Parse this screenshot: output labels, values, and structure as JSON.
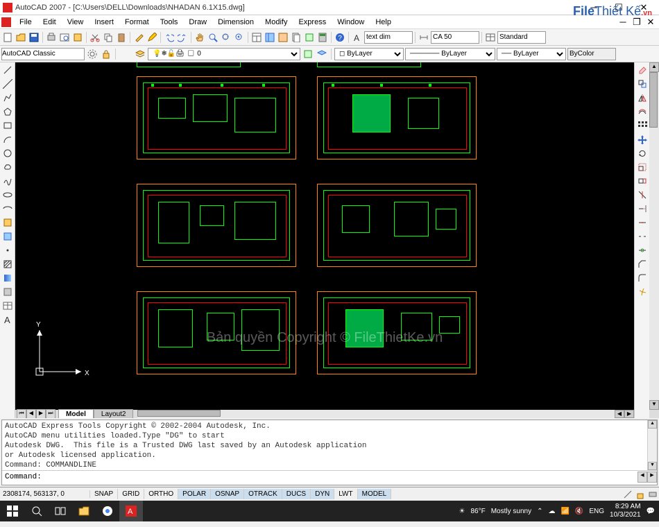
{
  "window": {
    "title": "AutoCAD 2007 - [C:\\Users\\DELL\\Downloads\\NHADAN 6.1X15.dwg]"
  },
  "menu": {
    "items": [
      "File",
      "Edit",
      "View",
      "Insert",
      "Format",
      "Tools",
      "Draw",
      "Dimension",
      "Modify",
      "Express",
      "Window",
      "Help"
    ]
  },
  "toolbars": {
    "textstyle": "text dim",
    "dimstyle": "CA 50",
    "tablestyle": "Standard",
    "workspace": "AutoCAD Classic",
    "layer": "0",
    "layerprop1": "ByLayer",
    "layerprop2": "ByLayer",
    "layerprop3": "ByLayer",
    "plotstyle": "ByColor"
  },
  "tabs": {
    "model": "Model",
    "layout": "Layout2"
  },
  "command": {
    "history": "AutoCAD Express Tools Copyright © 2002-2004 Autodesk, Inc.\nAutoCAD menu utilities loaded.Type \"DG\" to start\nAutodesk DWG.  This file is a Trusted DWG last saved by an Autodesk application\nor Autodesk licensed application.\nCommand: COMMANDLINE",
    "prompt": "Command:"
  },
  "status": {
    "coords": "2308174, 563137, 0",
    "buttons": [
      "SNAP",
      "GRID",
      "ORTHO",
      "POLAR",
      "OSNAP",
      "OTRACK",
      "DUCS",
      "DYN",
      "LWT",
      "MODEL"
    ]
  },
  "taskbar": {
    "weather_temp": "86°F",
    "weather_cond": "Mostly sunny",
    "lang": "ENG",
    "time": "8:29 AM",
    "date": "10/3/2021"
  },
  "watermark": {
    "brand1": "File",
    "brand2": "Thiết Kế",
    "tld": ".vn",
    "canvas": "Bản quyền Copyright © FileThietKe.vn"
  },
  "ucs": {
    "x": "X",
    "y": "Y"
  }
}
